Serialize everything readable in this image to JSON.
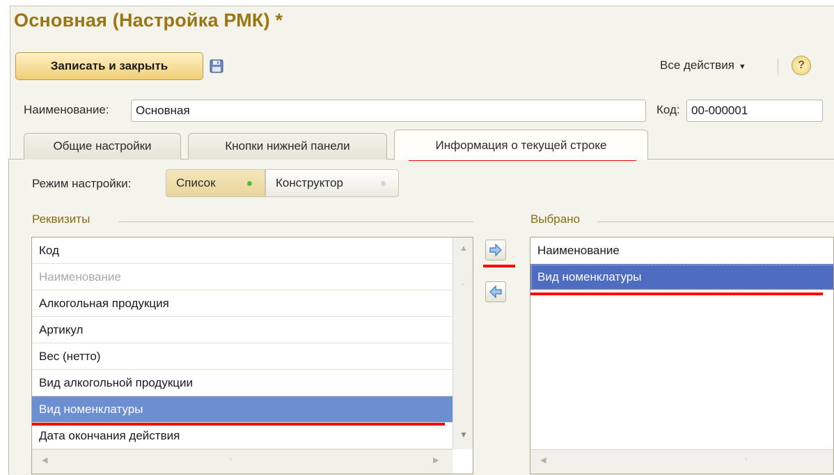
{
  "window": {
    "title": "Основная (Настройка РМК) *"
  },
  "toolbar": {
    "save_close_label": "Записать и закрыть",
    "save_icon": "floppy-disk-icon",
    "all_actions_label": "Все действия",
    "help_label": "?"
  },
  "form": {
    "name_label": "Наименование:",
    "name_value": "Основная",
    "code_label": "Код:",
    "code_value": "00-000001"
  },
  "tabs": [
    {
      "label": "Общие настройки"
    },
    {
      "label": "Кнопки нижней панели"
    },
    {
      "label": "Информация о текущей строке",
      "active": true
    }
  ],
  "mode": {
    "label": "Режим настройки:",
    "options": [
      {
        "label": "Список",
        "selected": true
      },
      {
        "label": "Конструктор",
        "selected": false
      }
    ]
  },
  "requisites": {
    "title": "Реквизиты",
    "items": [
      "Код",
      "Наименование",
      "Алкогольная продукция",
      "Артикул",
      "Вес (нетто)",
      "Вид алкогольной продукции",
      "Вид номенклатуры",
      "Дата окончания действия"
    ],
    "dimmed_index": 1,
    "selected_index": 6
  },
  "selected": {
    "title": "Выбрано",
    "items": [
      "Наименование",
      "Вид номенклатуры"
    ],
    "selected_index": 1
  },
  "colors": {
    "title": "#9a7512",
    "selection": "#6b8fd0",
    "selection_active": "#4e6dc0",
    "annotation": "#ff0000"
  }
}
